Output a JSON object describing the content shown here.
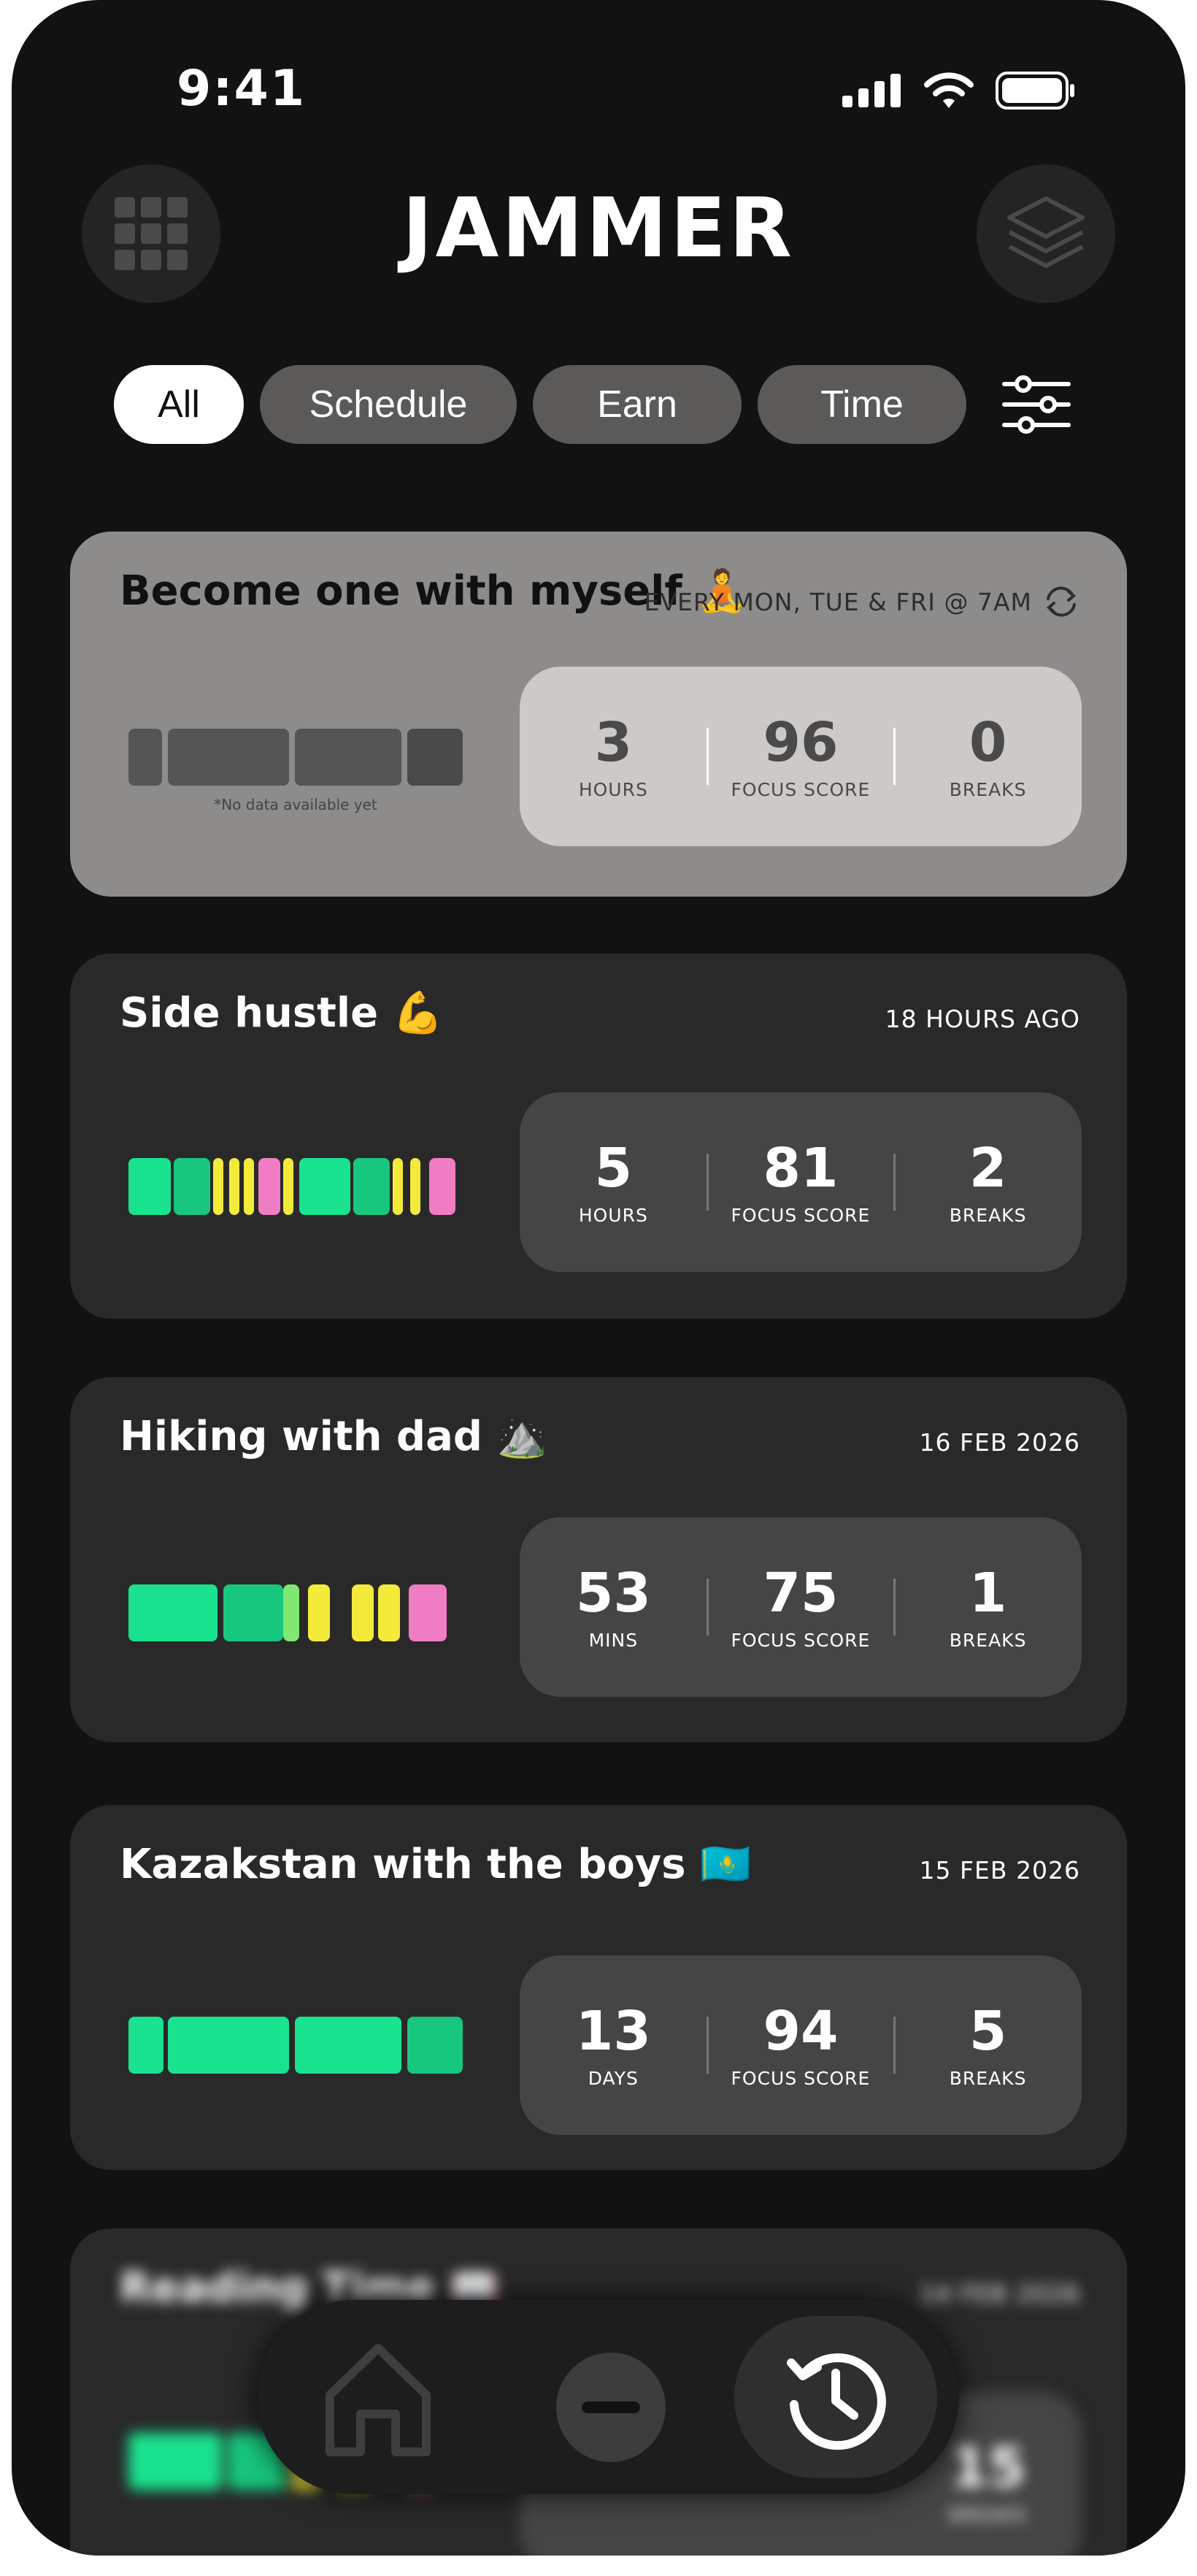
{
  "status": {
    "time": "9:41"
  },
  "header": {
    "logo": "JAMMER",
    "left_icon": "grid-icon",
    "right_icon": "layers-icon"
  },
  "filters": {
    "chips": [
      {
        "label": "All",
        "active": true
      },
      {
        "label": "Schedule",
        "active": false
      },
      {
        "label": "Earn",
        "active": false
      },
      {
        "label": "Time",
        "active": false
      }
    ],
    "settings_icon": "sliders-icon"
  },
  "cards": [
    {
      "title": "Become one with myself 🧘",
      "meta": "EVERY MON, TUE & FRI @ 7AM",
      "meta_icon": "repeat-icon",
      "note": "*No data available yet",
      "stats": [
        {
          "value": "3",
          "label": "HOURS"
        },
        {
          "value": "96",
          "label": "FOCUS SCORE"
        },
        {
          "value": "0",
          "label": "BREAKS"
        }
      ]
    },
    {
      "title": "Side hustle 💪",
      "meta": "18 HOURS AGO",
      "stats": [
        {
          "value": "5",
          "label": "HOURS"
        },
        {
          "value": "81",
          "label": "FOCUS SCORE"
        },
        {
          "value": "2",
          "label": "BREAKS"
        }
      ]
    },
    {
      "title": "Hiking with dad ⛰️",
      "meta": "16 FEB 2026",
      "stats": [
        {
          "value": "53",
          "label": "MINS"
        },
        {
          "value": "75",
          "label": "FOCUS SCORE"
        },
        {
          "value": "1",
          "label": "BREAKS"
        }
      ]
    },
    {
      "title": "Kazakstan with the boys 🇰🇿",
      "meta": "15 FEB 2026",
      "stats": [
        {
          "value": "13",
          "label": "DAYS"
        },
        {
          "value": "94",
          "label": "FOCUS SCORE"
        },
        {
          "value": "5",
          "label": "BREAKS"
        }
      ]
    },
    {
      "title": "Reading Time 📖",
      "meta": "14 FEB 2026",
      "stats": [
        {
          "value": "",
          "label": ""
        },
        {
          "value": "",
          "label": ""
        },
        {
          "value": "15",
          "label": "BREAKS"
        }
      ]
    }
  ],
  "colors": {
    "green": "#19e38f",
    "yellow": "#f3ea3a",
    "pink": "#f07cc3",
    "card_bg": "#292929",
    "scheduled_bg": "#8d8c8b"
  },
  "nav": {
    "home_icon": "home-icon",
    "minus_icon": "minus-icon",
    "history_icon": "history-icon"
  }
}
